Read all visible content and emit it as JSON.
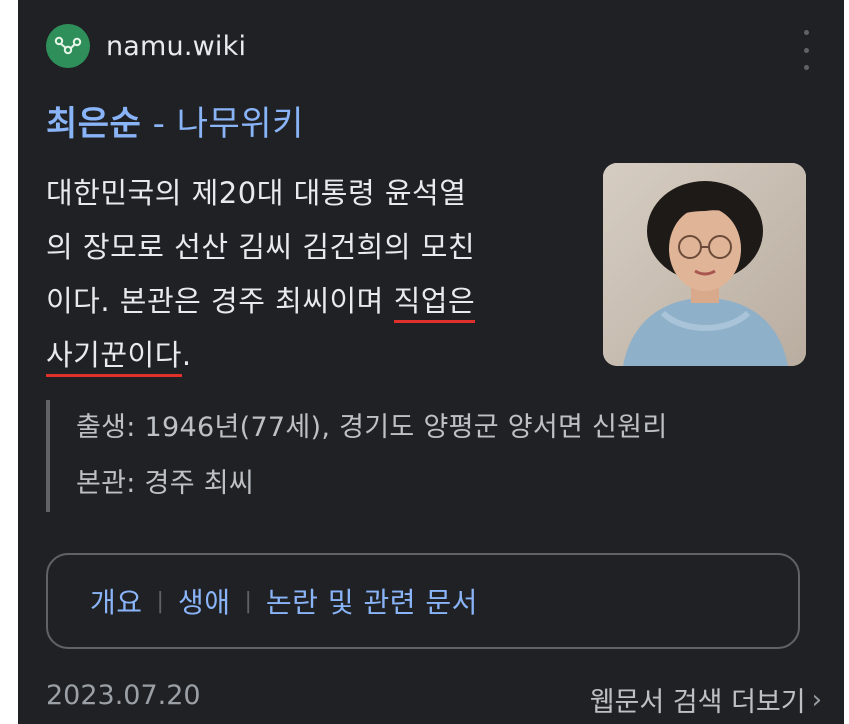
{
  "result": {
    "site_name": "namu.wiki",
    "favicon_icon": "namu-wiki-logo-icon",
    "title_main": "최은순",
    "title_sep": " - ",
    "title_site": "나무위키",
    "snippet": {
      "line1": "대한민국의 제20대 대통령 윤석열",
      "line2": "의 장모로 선산 김씨 김건희의 모친",
      "line3_pre": "이다. 본관은 경주 최씨이며 ",
      "line3_hl": "직업은",
      "line4_hl": "사기꾼이다",
      "line4_post": "."
    },
    "facts": [
      "출생: 1946년(77세), 경기도 양평군 양서면 신원리",
      "본관: 경주 최씨"
    ],
    "nav_links": [
      "개요",
      "생애",
      "논란 및 관련 문서"
    ],
    "nav_sep": "|",
    "date": "2023.07.20",
    "more_results": "웹문서 검색 더보기",
    "chevron": "›"
  },
  "colors": {
    "card_bg": "#202124",
    "link": "#8ab4f8",
    "text": "#e8eaed",
    "muted": "#9aa0a6",
    "highlight_underline": "#e0302c"
  }
}
